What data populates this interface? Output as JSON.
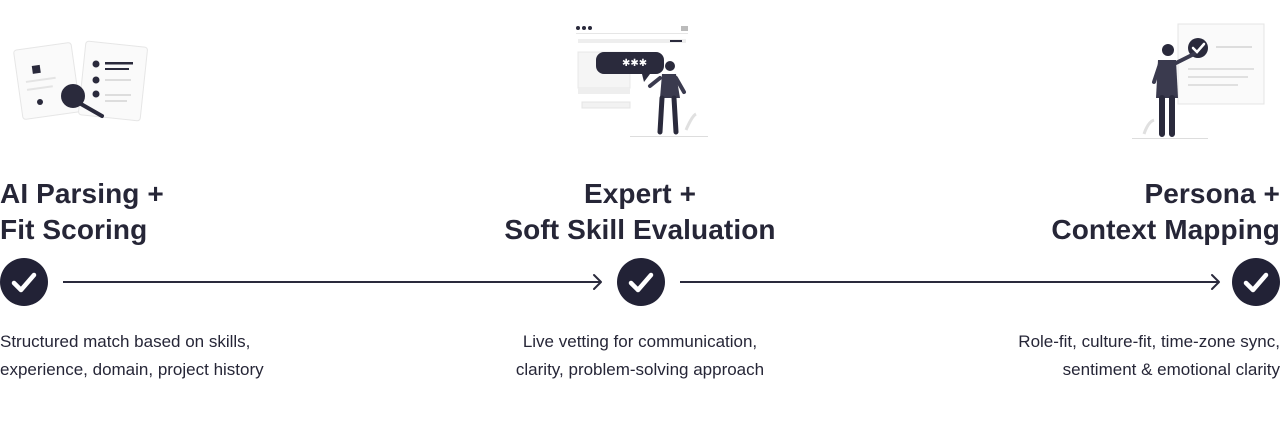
{
  "steps": [
    {
      "title_line1": "AI Parsing +",
      "title_line2": "Fit Scoring",
      "desc_line1": "Structured match based on skills,",
      "desc_line2": "experience, domain, project history",
      "illustration": "documents-magnifier-icon"
    },
    {
      "title_line1": "Expert +",
      "title_line2": "Soft Skill Evaluation",
      "desc_line1": "Live vetting for communication,",
      "desc_line2": "clarity, problem-solving approach",
      "illustration": "person-chat-bubble-icon"
    },
    {
      "title_line1": "Persona +",
      "title_line2": "Context Mapping",
      "desc_line1": "Role-fit, culture-fit, time-zone sync,",
      "desc_line2": "sentiment & emotional clarity",
      "illustration": "person-board-check-icon"
    }
  ],
  "colors": {
    "accent": "#222236",
    "text": "#262637",
    "line": "#2a2a3c"
  }
}
